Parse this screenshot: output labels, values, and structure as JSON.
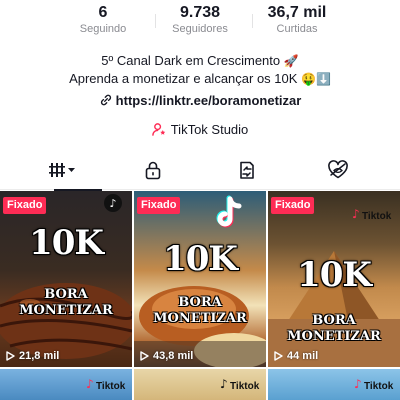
{
  "stats": {
    "following": {
      "value": "6",
      "label": "Seguindo"
    },
    "followers": {
      "value": "9.738",
      "label": "Seguidores"
    },
    "likes": {
      "value": "36,7 mil",
      "label": "Curtidas"
    }
  },
  "bio": {
    "line1": "5º Canal Dark em Crescimento",
    "line1_emoji": "🚀",
    "line2": "Aprenda a monetizar e alcançar os 10K",
    "line2_emoji": "🤑⬇️",
    "link": "https://linktr.ee/boramonetizar"
  },
  "studio": {
    "label": "TikTok Studio"
  },
  "tabs": [
    {
      "icon": "grid-icon",
      "active": true
    },
    {
      "icon": "lock-icon",
      "active": false
    },
    {
      "icon": "repost-icon",
      "active": false
    },
    {
      "icon": "heart-hidden-icon",
      "active": false
    }
  ],
  "videos": [
    {
      "pinned_label": "Fixado",
      "title": "10K",
      "subtitle_1": "BORA",
      "subtitle_2": "MONETIZAR",
      "views": "21,8 mil"
    },
    {
      "pinned_label": "Fixado",
      "title": "10K",
      "subtitle_1": "BORA",
      "subtitle_2": "MONETIZAR",
      "views": "43,8 mil"
    },
    {
      "pinned_label": "Fixado",
      "title": "10K",
      "subtitle_1": "BORA",
      "subtitle_2": "MONETIZAR",
      "views": "44 mil"
    }
  ],
  "colors": {
    "accent": "#fe2c55",
    "text": "#161823",
    "muted": "#8a8b91"
  }
}
